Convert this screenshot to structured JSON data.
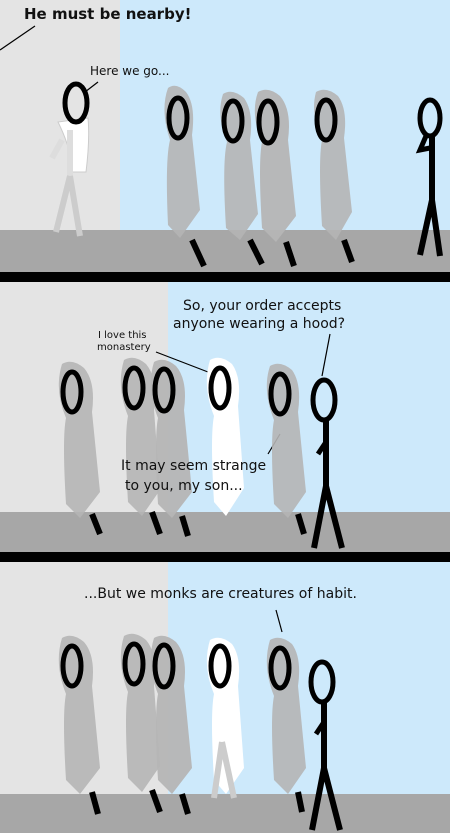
{
  "panels": [
    {
      "captions": {
        "main": "He must be nearby!",
        "reply": "Here we go..."
      }
    },
    {
      "captions": {
        "question_line1": "So, your order accepts",
        "question_line2": "anyone wearing a hood?",
        "aside_line1": "I love this",
        "aside_line2": "monastery",
        "answer_line1": "It may seem strange",
        "answer_line2": "to you, my son..."
      }
    },
    {
      "captions": {
        "punchline": "...But we monks are creatures of habit."
      }
    }
  ],
  "colors": {
    "wall_left": "#e4e4e4",
    "wall_right": "#cde9fb",
    "floor": "#a7a7a7",
    "divider": "#000000",
    "hood_gray": "#b5b5b5",
    "hood_white": "#ffffff",
    "ink": "#000000"
  }
}
